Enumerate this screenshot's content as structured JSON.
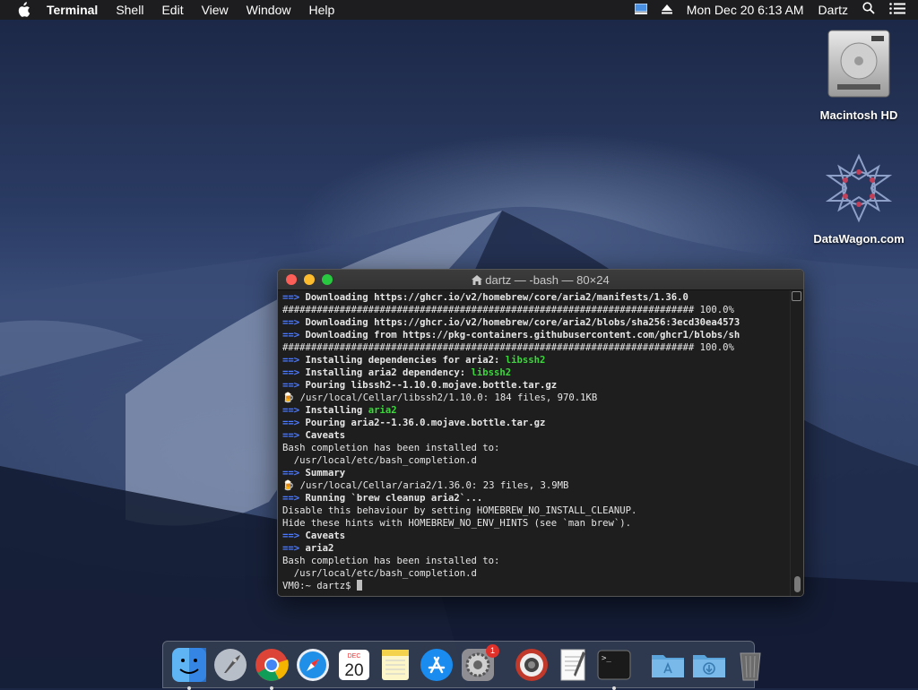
{
  "menubar": {
    "app_name": "Terminal",
    "menus": [
      "Shell",
      "Edit",
      "View",
      "Window",
      "Help"
    ],
    "clock": "Mon Dec 20  6:13 AM",
    "user": "Dartz"
  },
  "desktop": {
    "icons": [
      {
        "label": "Macintosh HD",
        "icon": "hard-drive-icon"
      },
      {
        "label": "DataWagon.com",
        "icon": "datawagon-logo-icon"
      }
    ]
  },
  "terminal": {
    "title": "dartz — -bash — 80×24",
    "lines": [
      {
        "prefix": "==>",
        "text": "Downloading https://ghcr.io/v2/homebrew/core/aria2/manifests/1.36.0",
        "style": "bold"
      },
      {
        "prefix": "",
        "text": "######################################################################## 100.0%",
        "style": "plain"
      },
      {
        "prefix": "==>",
        "text": "Downloading https://ghcr.io/v2/homebrew/core/aria2/blobs/sha256:3ecd30ea4573",
        "style": "bold"
      },
      {
        "prefix": "==>",
        "text": "Downloading from https://pkg-containers.githubusercontent.com/ghcr1/blobs/sh",
        "style": "bold"
      },
      {
        "prefix": "",
        "text": "######################################################################## 100.0%",
        "style": "plain"
      },
      {
        "prefix": "==>",
        "text": "Installing dependencies for aria2: ",
        "style": "bold",
        "highlight": "libssh2"
      },
      {
        "prefix": "==>",
        "text": "Installing aria2 dependency: ",
        "style": "bold",
        "highlight": "libssh2"
      },
      {
        "prefix": "==>",
        "text": "Pouring libssh2--1.10.0.mojave.bottle.tar.gz",
        "style": "bold"
      },
      {
        "prefix": "🍺",
        "text": "/usr/local/Cellar/libssh2/1.10.0: 184 files, 970.1KB",
        "style": "plain"
      },
      {
        "prefix": "==>",
        "text": "Installing ",
        "style": "bold",
        "highlight": "aria2"
      },
      {
        "prefix": "==>",
        "text": "Pouring aria2--1.36.0.mojave.bottle.tar.gz",
        "style": "bold"
      },
      {
        "prefix": "==>",
        "text": "Caveats",
        "style": "bold"
      },
      {
        "prefix": "",
        "text": "Bash completion has been installed to:",
        "style": "plain"
      },
      {
        "prefix": "",
        "text": "  /usr/local/etc/bash_completion.d",
        "style": "plain"
      },
      {
        "prefix": "==>",
        "text": "Summary",
        "style": "bold"
      },
      {
        "prefix": "🍺",
        "text": "/usr/local/Cellar/aria2/1.36.0: 23 files, 3.9MB",
        "style": "plain"
      },
      {
        "prefix": "==>",
        "text": "Running `brew cleanup aria2`...",
        "style": "bold"
      },
      {
        "prefix": "",
        "text": "Disable this behaviour by setting HOMEBREW_NO_INSTALL_CLEANUP.",
        "style": "plain"
      },
      {
        "prefix": "",
        "text": "Hide these hints with HOMEBREW_NO_ENV_HINTS (see `man brew`).",
        "style": "plain"
      },
      {
        "prefix": "==>",
        "text": "Caveats",
        "style": "bold"
      },
      {
        "prefix": "==>",
        "text": "aria2",
        "style": "bold"
      },
      {
        "prefix": "",
        "text": "Bash completion has been installed to:",
        "style": "plain"
      },
      {
        "prefix": "",
        "text": "  /usr/local/etc/bash_completion.d",
        "style": "plain"
      }
    ],
    "prompt": "VM0:~ dartz$ "
  },
  "dock": {
    "apps": [
      {
        "name": "finder-icon",
        "running": true
      },
      {
        "name": "launchpad-icon",
        "running": false
      },
      {
        "name": "chrome-icon",
        "running": true
      },
      {
        "name": "safari-icon",
        "running": false
      },
      {
        "name": "calendar-icon",
        "running": false,
        "month": "DEC",
        "day": "20"
      },
      {
        "name": "notes-icon",
        "running": false
      },
      {
        "name": "app-store-icon",
        "running": false
      },
      {
        "name": "system-preferences-icon",
        "running": false,
        "badge": "1"
      },
      {
        "name": "photo-booth-icon",
        "running": false
      },
      {
        "name": "textedit-icon",
        "running": false
      },
      {
        "name": "terminal-icon",
        "running": true
      },
      {
        "name": "applications-folder-icon",
        "running": false
      },
      {
        "name": "downloads-folder-icon",
        "running": false
      },
      {
        "name": "trash-icon",
        "running": false
      }
    ]
  }
}
